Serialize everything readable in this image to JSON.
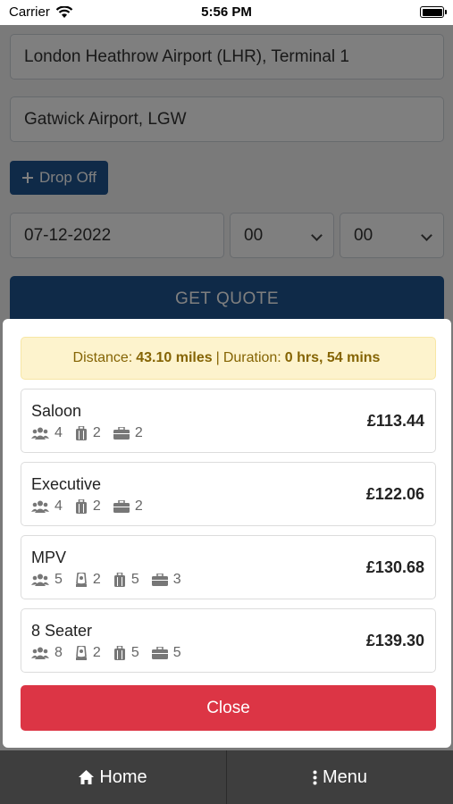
{
  "status_bar": {
    "carrier": "Carrier",
    "time": "5:56 PM"
  },
  "form": {
    "pickup": "London Heathrow Airport (LHR), Terminal 1",
    "destination": "Gatwick Airport, LGW",
    "dropoff_button": "Drop Off",
    "date": "07-12-2022",
    "hour": "00",
    "minute": "00",
    "quote_button": "GET QUOTE"
  },
  "quote_modal": {
    "distance_label": "Distance:",
    "distance_value": "43.10 miles",
    "separator": "|",
    "duration_label": "Duration:",
    "duration_value": "0 hrs, 54 mins",
    "vehicles": [
      {
        "name": "Saloon",
        "price": "£113.44",
        "passengers": "4",
        "hand_luggage": "2",
        "suitcases": "2"
      },
      {
        "name": "Executive",
        "price": "£122.06",
        "passengers": "4",
        "hand_luggage": "2",
        "suitcases": "2"
      },
      {
        "name": "MPV",
        "price": "£130.68",
        "passengers": "5",
        "child_seats": "2",
        "hand_luggage": "5",
        "suitcases": "3"
      },
      {
        "name": "8 Seater",
        "price": "£139.30",
        "passengers": "8",
        "child_seats": "2",
        "hand_luggage": "5",
        "suitcases": "5"
      }
    ],
    "close_button": "Close"
  },
  "bottom_nav": {
    "home": "Home",
    "menu": "Menu"
  },
  "colors": {
    "primary": "#1f5590",
    "danger": "#dc3545",
    "info_bg": "#fdf3cd",
    "info_text": "#856404",
    "nav_bg": "#3e3e3e"
  },
  "icons": [
    "wifi-icon",
    "battery-icon",
    "plus-icon",
    "chevron-down-icon",
    "passengers-icon",
    "child-seat-icon",
    "hand-luggage-icon",
    "suitcase-icon",
    "home-icon",
    "menu-dots-icon"
  ]
}
